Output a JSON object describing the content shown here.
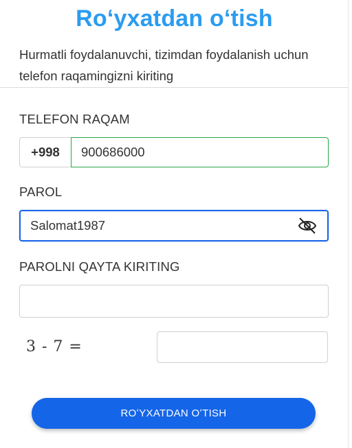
{
  "form": {
    "title": "Roʻyxatdan oʻtish",
    "subtitle": "Hurmatli foydalanuvchi, tizimdan foydalanish uchun telefon raqamingizni kiriting",
    "phone": {
      "label": "TELEFON RAQAM",
      "prefix": "+998",
      "value": "900686000"
    },
    "password": {
      "label": "PAROL",
      "value": "Salomat1987",
      "toggle_icon": "eye-slash-icon"
    },
    "password_repeat": {
      "label": "PAROLNI QAYTA KIRITING",
      "value": ""
    },
    "captcha": {
      "expression": "3 - 7 =",
      "answer": ""
    },
    "submit_label": "ROʻYXATDAN OʻTISH"
  },
  "colors": {
    "title": "#2b9cf0",
    "primary_button": "#1565e8",
    "valid_border": "#28a745",
    "focus_border": "#1a66e6"
  }
}
